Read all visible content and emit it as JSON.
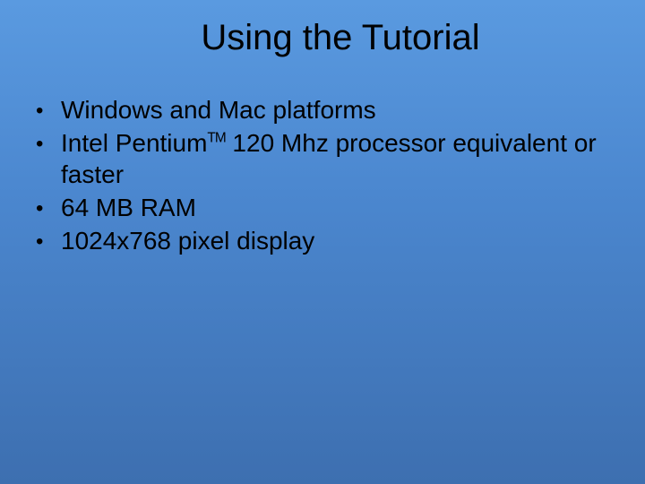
{
  "title": "Using the Tutorial",
  "bullets": [
    {
      "text": "Windows and Mac platforms"
    },
    {
      "prefix": "Intel Pentium",
      "tm": "TM",
      "suffix": " 120 Mhz processor equivalent or faster"
    },
    {
      "text": "64 MB RAM"
    },
    {
      "text": "1024x768 pixel display"
    }
  ]
}
